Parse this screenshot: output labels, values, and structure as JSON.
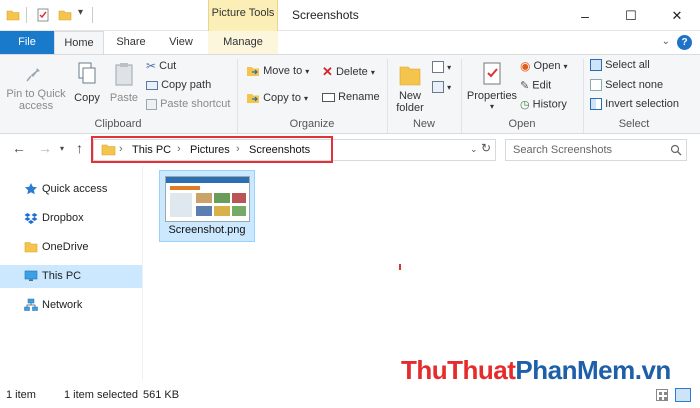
{
  "window": {
    "context_tab": "Picture Tools",
    "title": "Screenshots",
    "minimize": "–",
    "maximize": "☐",
    "close": "✕"
  },
  "tabs": [
    "File",
    "Home",
    "Share",
    "View",
    "Manage"
  ],
  "ribbon": {
    "clipboard": {
      "label": "Clipboard",
      "pin_line1": "Pin to Quick",
      "pin_line2": "access",
      "copy": "Copy",
      "paste": "Paste",
      "cut": "Cut",
      "copy_path": "Copy path",
      "paste_shortcut": "Paste shortcut"
    },
    "organize": {
      "label": "Organize",
      "move_to": "Move to",
      "copy_to": "Copy to",
      "delete": "Delete",
      "rename": "Rename"
    },
    "new": {
      "label": "New",
      "new_folder_line1": "New",
      "new_folder_line2": "folder"
    },
    "open": {
      "label": "Open",
      "properties": "Properties",
      "open": "Open",
      "edit": "Edit",
      "history": "History"
    },
    "select": {
      "label": "Select",
      "select_all": "Select all",
      "select_none": "Select none",
      "invert": "Invert selection"
    }
  },
  "address": {
    "crumbs": [
      "This PC",
      "Pictures",
      "Screenshots"
    ],
    "search_placeholder": "Search Screenshots"
  },
  "nav": {
    "items": [
      {
        "label": "Quick access",
        "icon": "star-icon"
      },
      {
        "label": "Dropbox",
        "icon": "dropbox-icon"
      },
      {
        "label": "OneDrive",
        "icon": "folder-icon"
      },
      {
        "label": "This PC",
        "icon": "monitor-icon"
      },
      {
        "label": "Network",
        "icon": "network-icon"
      }
    ]
  },
  "files": [
    {
      "name": "Screenshot.png"
    }
  ],
  "status": {
    "count": "1 item",
    "selected": "1 item selected",
    "size": "561 KB"
  },
  "watermark": {
    "part1": "Thu",
    "part2": "Thuat",
    "part3": "PhanMem",
    "part4": ".vn"
  },
  "colors": {
    "accent": "#1979ca",
    "context_tab": "#fbeeb6",
    "selection": "#cce8ff",
    "highlight_box": "#e3313b"
  }
}
